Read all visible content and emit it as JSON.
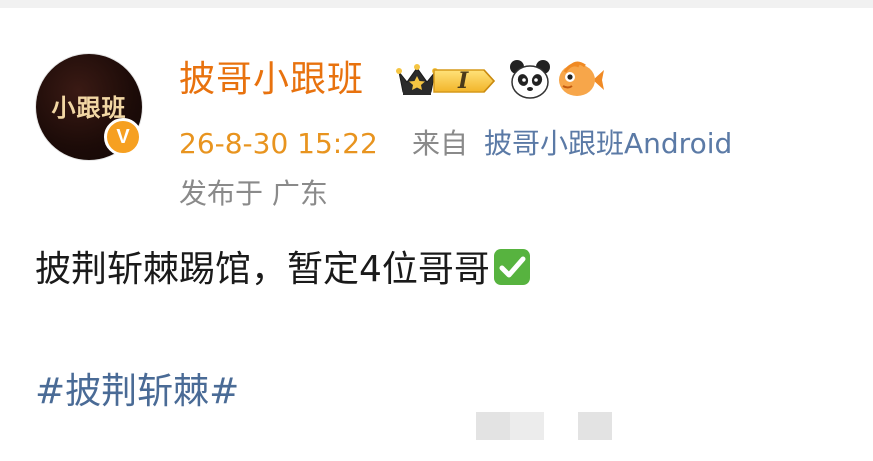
{
  "post": {
    "avatar_text": "小跟班",
    "verified_mark": "V",
    "username": "披哥小跟班",
    "level_label": "I",
    "timestamp": "26-8-30 15:22",
    "from_label": "来自",
    "source": "披哥小跟班Android",
    "location": "发布于 广东",
    "body": "披荆斩棘踢馆，暂定4位哥哥",
    "hashtag": "#披荆斩棘#"
  },
  "icons": {
    "badges": [
      "crown-icon",
      "level-badge",
      "panda-icon",
      "fish-icon"
    ],
    "check": "check-mark-icon"
  },
  "colors": {
    "username": "#e8720e",
    "timestamp": "#e8941f",
    "link": "#4a6b96",
    "verified": "#f6a021",
    "check_green": "#57b33f"
  }
}
